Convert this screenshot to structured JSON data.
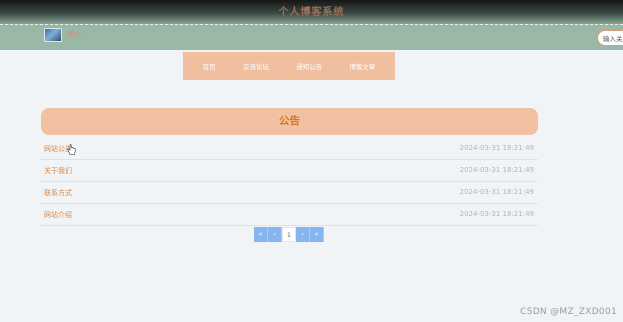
{
  "header": {
    "site_title": "个人博客系统",
    "user_name": "用户",
    "user_caret": "⌄",
    "search_value": "输入关"
  },
  "nav": {
    "items": [
      {
        "label": "首页"
      },
      {
        "label": "交流论坛"
      },
      {
        "label": "通知公告"
      },
      {
        "label": "博客文章"
      }
    ]
  },
  "section": {
    "title": "公告"
  },
  "notices": [
    {
      "title": "网站公告",
      "date": "2024-03-31 18:21:49"
    },
    {
      "title": "关于我们",
      "date": "2024-03-31 18:21:49"
    },
    {
      "title": "联系方式",
      "date": "2024-03-31 18:21:49"
    },
    {
      "title": "网站介绍",
      "date": "2024-03-31 18:21:49"
    }
  ],
  "pagination": {
    "first": "«",
    "prev": "‹",
    "current": "1",
    "next": "›",
    "last": "»"
  },
  "watermark": "CSDN @MZ_ZXD001",
  "colors": {
    "header_green": "#9bb7a5",
    "accent_peach": "#f0bf9f",
    "title_orange": "#d4781f",
    "link_orange": "#d4884a",
    "page_blue": "#86b5ef"
  },
  "icons": {
    "cursor": "hand-pointer-icon",
    "avatar": "user-avatar-image"
  }
}
